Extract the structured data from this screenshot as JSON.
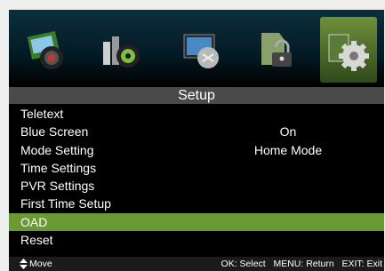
{
  "title": "Setup",
  "icons": [
    {
      "name": "picture-icon"
    },
    {
      "name": "sound-icon"
    },
    {
      "name": "channel-icon"
    },
    {
      "name": "lock-icon"
    },
    {
      "name": "setup-gear-icon"
    }
  ],
  "menu": [
    {
      "label": "Teletext",
      "value": ""
    },
    {
      "label": "Blue Screen",
      "value": "On"
    },
    {
      "label": "Mode Setting",
      "value": "Home Mode"
    },
    {
      "label": "Time Settings",
      "value": ""
    },
    {
      "label": "PVR Settings",
      "value": ""
    },
    {
      "label": "First Time Setup",
      "value": ""
    },
    {
      "label": "OAD",
      "value": ""
    },
    {
      "label": "Reset",
      "value": ""
    }
  ],
  "footer": {
    "move": "Move",
    "hints": "OK: Select   MENU: Return   EXIT: Exit"
  },
  "colors": {
    "highlight": "#6a9a33",
    "title_bar": "#4a4a4a"
  }
}
